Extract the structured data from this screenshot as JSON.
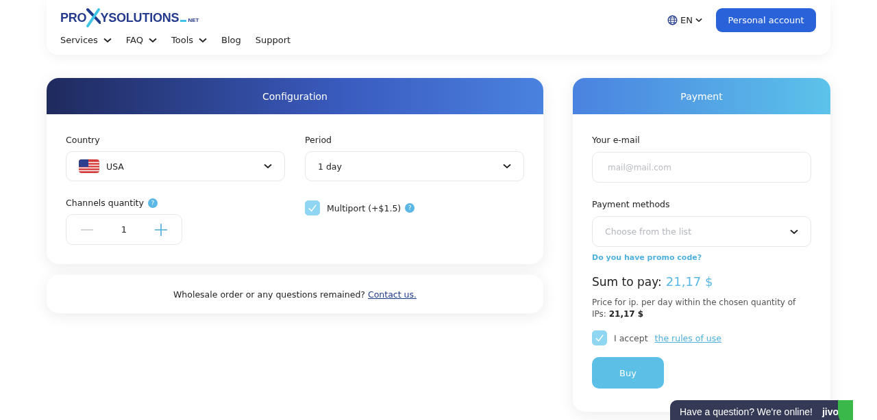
{
  "header": {
    "logo": {
      "left": "PRO",
      "right": "YSOLUTIONS",
      "suffix": "NET"
    },
    "nav": [
      {
        "label": "Services",
        "dropdown": true
      },
      {
        "label": "FAQ",
        "dropdown": true
      },
      {
        "label": "Tools",
        "dropdown": true
      },
      {
        "label": "Blog",
        "dropdown": false
      },
      {
        "label": "Support",
        "dropdown": false
      }
    ],
    "language": "EN",
    "account_button": "Personal account"
  },
  "configuration": {
    "title": "Configuration",
    "country": {
      "label": "Country",
      "value": "USA"
    },
    "period": {
      "label": "Period",
      "value": "1 day"
    },
    "channels": {
      "label": "Channels quantity",
      "help": "?",
      "value": "1"
    },
    "multiport": {
      "label": "Multiport (+$1.5)",
      "help": "?",
      "checked": true
    }
  },
  "wholesale": {
    "text": "Wholesale order or any questions remained?",
    "link": "Contact us."
  },
  "payment": {
    "title": "Payment",
    "email": {
      "label": "Your e-mail",
      "placeholder": "mail@mail.com"
    },
    "methods": {
      "label": "Payment methods",
      "placeholder": "Choose from the list"
    },
    "promo_link": "Do you have promo code?",
    "sum_label": "Sum to pay:",
    "sum_value": "21,17 $",
    "price_note": "Price for ip. per day within the chosen quantity of IPs: **21,17 $**",
    "accept": {
      "checked": true,
      "text": "I accept",
      "link": "the rules of use"
    },
    "buy_button": "Buy"
  },
  "chat": {
    "text": "Have a question? We're online!",
    "brand": "jivo"
  }
}
